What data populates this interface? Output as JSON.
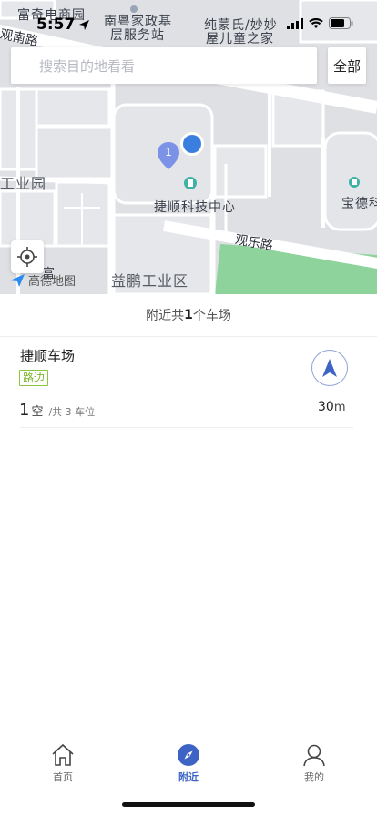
{
  "status_bar": {
    "time": "5:57"
  },
  "map": {
    "pois": [
      "富奇电商园",
      "南粤家政基",
      "层服务站",
      "纯蒙氏/妙妙",
      "屋儿童之家",
      "工业园",
      "捷顺科技中心",
      "宝德科",
      "益鹏工业区",
      "富"
    ],
    "roads": [
      "观南路",
      "观乐路"
    ],
    "marker_count": "1",
    "brand": "高德地图"
  },
  "search": {
    "placeholder": "搜索目的地看看",
    "all_label": "全部"
  },
  "summary": {
    "prefix": "附近共",
    "count": "1",
    "suffix": "个车场"
  },
  "lots": [
    {
      "name": "捷顺车场",
      "tag": "路边",
      "free": "1",
      "free_unit": "空",
      "total": "/共 3 车位",
      "distance": "30",
      "distance_unit": "m"
    }
  ],
  "tabs": [
    {
      "label": "首页",
      "icon": "home-icon"
    },
    {
      "label": "附近",
      "icon": "compass-icon"
    },
    {
      "label": "我的",
      "icon": "user-icon"
    }
  ],
  "colors": {
    "accent": "#3d63c4",
    "tag_green": "#7bb52e",
    "park_green": "#8ed39b",
    "map_bg": "#dfe0e4"
  }
}
